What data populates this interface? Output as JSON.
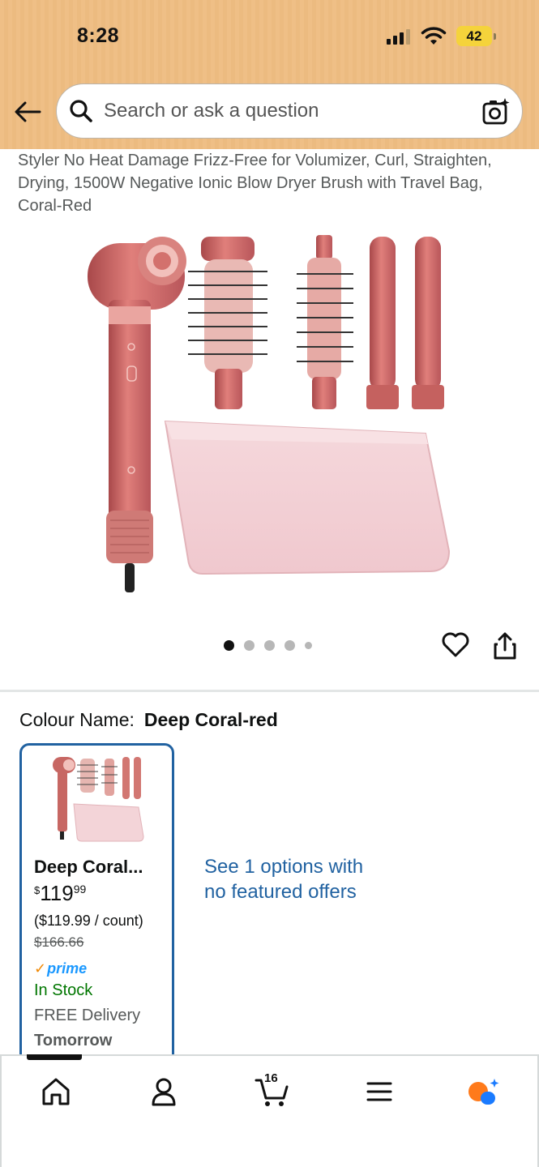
{
  "status_bar": {
    "time": "8:28",
    "battery": "42"
  },
  "header": {
    "search_placeholder": "Search or ask a question"
  },
  "product": {
    "title": "Styler No Heat Damage Frizz-Free for Volumizer, Curl, Straighten, Drying, 1500W Negative Ionic Blow Dryer Brush with Travel Bag, Coral-Red",
    "image_dots_total": 5,
    "image_dot_active": 1
  },
  "colour": {
    "label": "Colour Name:",
    "value": "Deep Coral-red"
  },
  "swatch": {
    "name": "Deep Coral...",
    "currency": "$",
    "price_whole": "119",
    "price_cents": "99",
    "unit_price": "($119.99 / count)",
    "list_price": "$166.66",
    "prime_check": "✓",
    "prime_label": "prime",
    "stock": "In Stock",
    "delivery": "FREE Delivery",
    "delivery_day": "Tomorrow"
  },
  "see_options": "See 1 options with no featured offers",
  "bottom_nav": {
    "cart_count": "16",
    "items": [
      "home-icon",
      "account-icon",
      "cart-icon",
      "menu-icon",
      "rufus-icon"
    ]
  },
  "colors": {
    "header_bg": "#efbf86",
    "link": "#2162a1",
    "in_stock": "#007600",
    "prime": "#1a98ff",
    "swatch_border": "#2162a1"
  }
}
